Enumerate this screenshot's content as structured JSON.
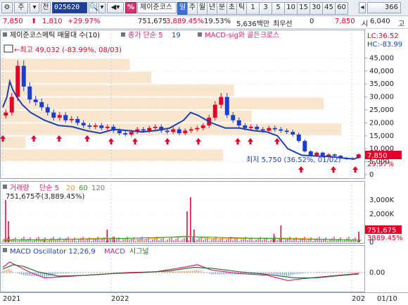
{
  "toolbar": {
    "dropdown1_label": "주",
    "prev_label": "전",
    "code_value": "025620",
    "pct_label": "%",
    "stock_name": "제이준코스",
    "period_buttons": [
      "일",
      "주",
      "월",
      "년",
      "분",
      "초",
      "틱"
    ],
    "active_period": "일",
    "minute_buttons": [
      "1",
      "3",
      "5",
      "10",
      "15",
      "30",
      "45",
      "60"
    ],
    "count_value": "366"
  },
  "quote": {
    "price": "7,850",
    "change": "1,810",
    "change_pct": "+29.97%",
    "volume": "751,675",
    "volume_ratio": "3,889.45%",
    "turnover": "19.53%",
    "trade_value": "5,636백만",
    "session": "최우선",
    "session_value": "0",
    "bid_price": "7,850",
    "open_label": "시",
    "open_value": "6,040",
    "high_label": "고"
  },
  "price_panel": {
    "legend_title": "제이준코스메틱 매물대 수(10)",
    "legend_ma": "종가 단순 5",
    "legend_ma_value": "19",
    "legend_macd_signal": "MACD-sig와 골든크로스",
    "lc_label": "LC:36.52",
    "hc_label": "HC:-83.99",
    "max_annotation": "←최고 49,032 (-83.99%, 08/03)",
    "min_annotation": "최저 5,750 (36.52%, 01/02)",
    "current_price_tag": "7,850",
    "current_pct_tag": "29.97%"
  },
  "volume_panel": {
    "legend_title": "거래량",
    "legend_ma": "단순 5",
    "legend_periods": [
      "20",
      "60",
      "120"
    ],
    "legend_value": "751,675주(3,889.45%)",
    "current_tag": "751,675",
    "current_pct_tag": "3889.45%"
  },
  "macd_panel": {
    "legend_title": "MACD Oscillator 12,26,9",
    "legend_macd": "MACD",
    "legend_signal": "시그널"
  },
  "x_axis": {
    "labels": [
      "2021",
      "2022",
      "202",
      "01/10"
    ]
  },
  "colors": {
    "up": "#e0002a",
    "down": "#1a3fd0",
    "ma": "#1e3fb0",
    "volume_profile": "#f8e6cf",
    "accent_tag": "#e0002a"
  },
  "chart_data": [
    {
      "type": "line",
      "title": "",
      "panel": "price",
      "ylabel": "",
      "ylim": [
        0,
        50000
      ],
      "y_ticks": [
        "45,000",
        "40,000",
        "35,000",
        "30,000",
        "25,000",
        "20,000",
        "15,000",
        "10,000",
        "5,000",
        "0"
      ],
      "y_tick_values": [
        45000,
        40000,
        35000,
        30000,
        25000,
        20000,
        15000,
        10000,
        5000,
        0
      ],
      "x_range_days": 516,
      "series": [
        {
          "name": "종가 단순 5",
          "points": [
            [
              0,
              26000
            ],
            [
              6,
              30000
            ],
            [
              10,
              36000
            ],
            [
              14,
              33000
            ],
            [
              20,
              30000
            ],
            [
              28,
              27000
            ],
            [
              40,
              24000
            ],
            [
              60,
              21000
            ],
            [
              80,
              19000
            ],
            [
              100,
              18500
            ],
            [
              120,
              17000
            ],
            [
              140,
              16000
            ],
            [
              160,
              17500
            ],
            [
              180,
              17000
            ],
            [
              200,
              16500
            ],
            [
              220,
              17000
            ],
            [
              240,
              18000
            ],
            [
              260,
              21000
            ],
            [
              270,
              24000
            ],
            [
              280,
              23000
            ],
            [
              300,
              20000
            ],
            [
              320,
              18000
            ],
            [
              340,
              18000
            ],
            [
              360,
              17000
            ],
            [
              380,
              16500
            ],
            [
              395,
              15000
            ],
            [
              410,
              10000
            ],
            [
              430,
              7500
            ],
            [
              450,
              7200
            ],
            [
              470,
              7000
            ],
            [
              490,
              6400
            ],
            [
              505,
              6000
            ],
            [
              512,
              6800
            ]
          ]
        }
      ],
      "candle_closes": [
        24000,
        30000,
        42000,
        34000,
        29000,
        28000,
        26000,
        24000,
        22000,
        23000,
        21000,
        21500,
        20000,
        19000,
        18500,
        19000,
        18000,
        18500,
        17000,
        16000,
        15500,
        16500,
        17500,
        17000,
        18000,
        18500,
        17000,
        16500,
        17500,
        16000,
        17000,
        17500,
        18000,
        19000,
        22000,
        27000,
        30000,
        23000,
        21000,
        19000,
        18000,
        18500,
        17500,
        17000,
        18000,
        17500,
        17000,
        16500,
        15500,
        13000,
        9000,
        7500,
        8500,
        7000,
        7800,
        7300,
        6500,
        6000,
        6400,
        7850
      ],
      "volume_profile_bands": [
        {
          "from": 40000,
          "to": 45000,
          "relative": 0.36
        },
        {
          "from": 35000,
          "to": 40000,
          "relative": 0.42
        },
        {
          "from": 30000,
          "to": 35000,
          "relative": 0.65
        },
        {
          "from": 25000,
          "to": 30000,
          "relative": 0.9
        },
        {
          "from": 20000,
          "to": 25000,
          "relative": 0.7
        },
        {
          "from": 15000,
          "to": 20000,
          "relative": 0.95
        },
        {
          "from": 10000,
          "to": 15000,
          "relative": 0.07
        },
        {
          "from": 5000,
          "to": 10000,
          "relative": 0.62
        }
      ]
    },
    {
      "type": "bar",
      "title": "",
      "panel": "volume",
      "ylim": [
        0,
        3500000
      ],
      "y_ticks": [
        "3,000K",
        "2,000K",
        "1,000K",
        "0"
      ],
      "y_tick_values": [
        3000000,
        2000000,
        1000000,
        0
      ],
      "spikes": [
        [
          4,
          3000000
        ],
        [
          8,
          1500000
        ],
        [
          60,
          200000
        ],
        [
          150,
          900000
        ],
        [
          160,
          400000
        ],
        [
          265,
          2200000
        ],
        [
          270,
          3200000
        ],
        [
          275,
          900000
        ],
        [
          390,
          600000
        ],
        [
          400,
          1200000
        ],
        [
          512,
          751675
        ]
      ]
    },
    {
      "type": "line",
      "title": "",
      "panel": "macd",
      "ylim": [
        -1.0,
        1.0
      ],
      "y_ticks": [
        "0.00"
      ],
      "y_tick_values": [
        0
      ],
      "series": [
        {
          "name": "MACD",
          "points": [
            [
              0,
              0.3
            ],
            [
              10,
              0.6
            ],
            [
              20,
              0.4
            ],
            [
              40,
              0.0
            ],
            [
              60,
              -0.3
            ],
            [
              100,
              -0.2
            ],
            [
              140,
              -0.1
            ],
            [
              180,
              0.0
            ],
            [
              220,
              0.05
            ],
            [
              260,
              0.3
            ],
            [
              280,
              0.45
            ],
            [
              300,
              0.15
            ],
            [
              340,
              -0.05
            ],
            [
              380,
              -0.15
            ],
            [
              410,
              -0.45
            ],
            [
              430,
              -0.35
            ],
            [
              470,
              -0.2
            ],
            [
              512,
              -0.05
            ]
          ]
        },
        {
          "name": "시그널",
          "points": [
            [
              0,
              0.2
            ],
            [
              15,
              0.45
            ],
            [
              30,
              0.35
            ],
            [
              50,
              0.05
            ],
            [
              80,
              -0.2
            ],
            [
              120,
              -0.15
            ],
            [
              160,
              -0.05
            ],
            [
              200,
              0.0
            ],
            [
              240,
              0.1
            ],
            [
              275,
              0.3
            ],
            [
              300,
              0.25
            ],
            [
              340,
              0.05
            ],
            [
              380,
              -0.1
            ],
            [
              420,
              -0.3
            ],
            [
              450,
              -0.3
            ],
            [
              490,
              -0.15
            ],
            [
              512,
              -0.08
            ]
          ]
        }
      ]
    }
  ]
}
